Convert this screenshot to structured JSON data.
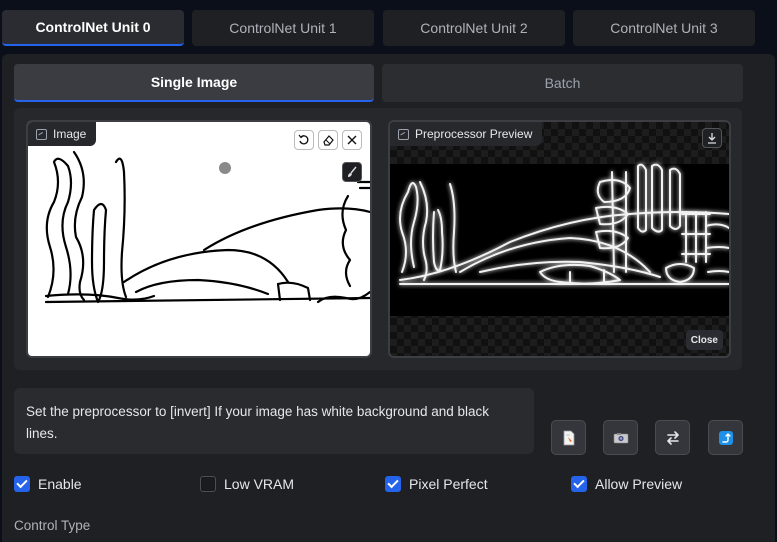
{
  "unit_tabs": [
    {
      "label": "ControlNet Unit 0",
      "active": true
    },
    {
      "label": "ControlNet Unit 1",
      "active": false
    },
    {
      "label": "ControlNet Unit 2",
      "active": false
    },
    {
      "label": "ControlNet Unit 3",
      "active": false
    }
  ],
  "mode_tabs": {
    "single": "Single Image",
    "batch": "Batch"
  },
  "image_panel": {
    "label": "Image",
    "icon": "image-icon",
    "tools": [
      "undo-icon",
      "eraser-icon",
      "close-icon",
      "brush-icon"
    ]
  },
  "preview_panel": {
    "label": "Preprocessor Preview",
    "icon": "image-icon",
    "download_icon": "download-icon",
    "close_label": "Close"
  },
  "hint": {
    "text": "Set the preprocessor to [invert] If your image has white background and black lines."
  },
  "action_buttons": [
    {
      "name": "new-canvas-icon",
      "glyph": "📄"
    },
    {
      "name": "camera-icon",
      "glyph": "📷"
    },
    {
      "name": "swap-icon",
      "glyph": "⇄"
    },
    {
      "name": "send-dimensions-icon",
      "glyph": "⤴"
    }
  ],
  "checkboxes": {
    "enable": {
      "label": "Enable",
      "checked": true
    },
    "low_vram": {
      "label": "Low VRAM",
      "checked": false
    },
    "pixel_perfect": {
      "label": "Pixel Perfect",
      "checked": true
    },
    "allow_preview": {
      "label": "Allow Preview",
      "checked": true
    }
  },
  "control_type": {
    "label": "Control Type"
  },
  "colors": {
    "accent": "#2563eb",
    "background": "#0b0f19",
    "panel": "#1f2023"
  }
}
